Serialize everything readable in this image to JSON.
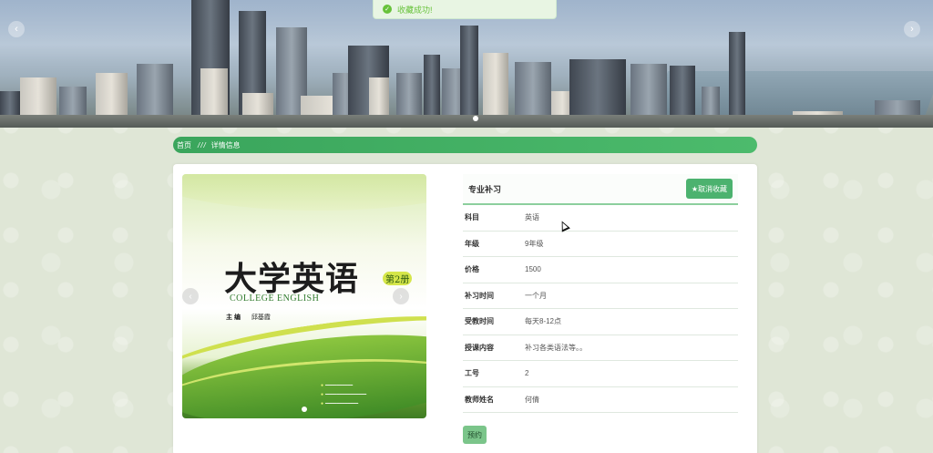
{
  "toast": {
    "message": "收藏成功!",
    "icon": "check-circle-icon"
  },
  "banner": {
    "prev_icon": "chevron-left-icon",
    "next_icon": "chevron-right-icon"
  },
  "breadcrumb": {
    "home": "首页",
    "separator": "///",
    "current": "详情信息"
  },
  "course": {
    "name": "专业补习",
    "favorite_button": "★取消收藏",
    "book_button": "预约",
    "cover": {
      "title_cn": "大学英语",
      "volume": "第2册",
      "title_en": "COLLEGE ENGLISH",
      "editor_label": "主 编",
      "editor_name": "邱基霞"
    },
    "fields": [
      {
        "key": "科目",
        "value": "英语"
      },
      {
        "key": "年级",
        "value": "9年级"
      },
      {
        "key": "价格",
        "value": "1500"
      },
      {
        "key": "补习时间",
        "value": "一个月"
      },
      {
        "key": "受教时间",
        "value": "每天8-12点"
      },
      {
        "key": "授课内容",
        "value": "补习各类语法等。。"
      },
      {
        "key": "工号",
        "value": "2"
      },
      {
        "key": "教师姓名",
        "value": "何倩"
      }
    ]
  },
  "colors": {
    "accent": "#4cb26f",
    "toast": "#67c23a"
  }
}
